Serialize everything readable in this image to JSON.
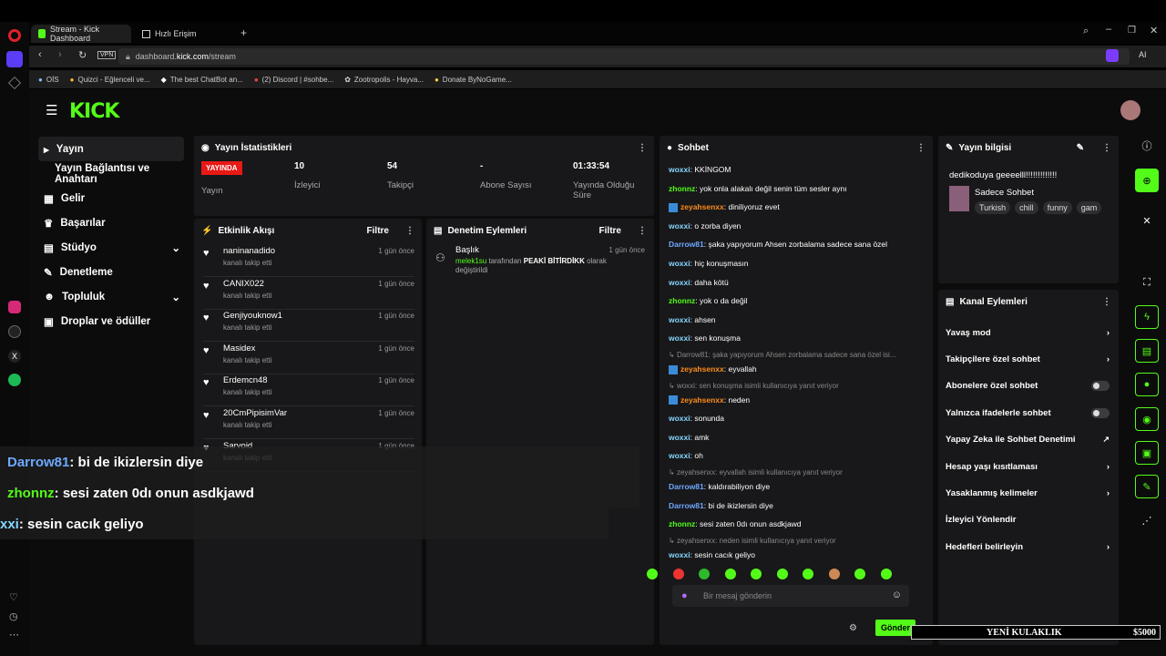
{
  "browser": {
    "tabs": [
      {
        "label": "Stream - Kick Dashboard"
      },
      {
        "label": "Hızlı Erişim"
      }
    ],
    "url_prefix": "dashboard.",
    "url_host": "kick.com",
    "url_path": "/stream",
    "vpn": "VPN",
    "ai": "AI",
    "bookmarks": [
      "OİS",
      "Quizci - Eğlenceli ve...",
      "The best ChatBot an...",
      "(2) Discord | #sohbe...",
      "Zootropolis - Hayva...",
      "Donate ByNoGame..."
    ]
  },
  "nav": {
    "items": [
      {
        "label": "Yayın",
        "icon": "broadcast-icon"
      },
      {
        "label": "Yayın Bağlantısı ve Anahtarı",
        "icon": ""
      },
      {
        "label": "Gelir",
        "icon": "chart-icon"
      },
      {
        "label": "Başarılar",
        "icon": "trophy-icon"
      },
      {
        "label": "Stüdyo",
        "icon": "studio-icon"
      },
      {
        "label": "Denetleme",
        "icon": "wrench-icon"
      },
      {
        "label": "Topluluk",
        "icon": "community-icon"
      },
      {
        "label": "Droplar ve ödüller",
        "icon": "gift-icon"
      }
    ]
  },
  "stats": {
    "title": "Yayın İstatistikleri",
    "live": "YAYINDA",
    "items": [
      {
        "value": "",
        "label": "Yayın"
      },
      {
        "value": "10",
        "label": "İzleyici"
      },
      {
        "value": "54",
        "label": "Takipçi"
      },
      {
        "value": "-",
        "label": "Abone Sayısı"
      },
      {
        "value": "01:33:54",
        "label": "Yayında Olduğu Süre"
      }
    ]
  },
  "activity": {
    "title": "Etkinlik Akışı",
    "filter": "Filtre",
    "items": [
      {
        "name": "naninanadido",
        "sub": "kanalı takip etti",
        "time": "1 gün önce"
      },
      {
        "name": "CANIX022",
        "sub": "kanalı takip etti",
        "time": "1 gün önce"
      },
      {
        "name": "Genjiyouknow1",
        "sub": "kanalı takip etti",
        "time": "1 gün önce"
      },
      {
        "name": "Masidex",
        "sub": "kanalı takip etti",
        "time": "1 gün önce"
      },
      {
        "name": "Erdemcn48",
        "sub": "kanalı takip etti",
        "time": "1 gün önce"
      },
      {
        "name": "20CmPipisimVar",
        "sub": "kanalı takip etti",
        "time": "1 gün önce"
      },
      {
        "name": "Sarvoid",
        "sub": "kanalı takip etti",
        "time": "1 gün önce"
      }
    ]
  },
  "moderation": {
    "title": "Denetim Eylemleri",
    "filter": "Filtre",
    "item_title": "Başlık",
    "item_user": "melek1su",
    "item_mid": " tarafından ",
    "item_value": "PEAKİ BİTİRDİKK",
    "item_end": " olarak değiştirildi",
    "time": "1 gün önce"
  },
  "chat": {
    "title": "Sohbet",
    "placeholder": "Bir mesaj gönderin",
    "send": "Gönder",
    "lines": [
      {
        "user": "woxxi",
        "text": "KKİNGOM",
        "color": "#84d6ff"
      },
      {
        "user": "zhonnz",
        "text": "yok onla alakalı değil senin tüm sesler aynı",
        "color": "#53fc18"
      },
      {
        "user": "zeyahsenxx",
        "text": "diniliyoruz evet",
        "color": "#ff8c1a"
      },
      {
        "user": "woxxi",
        "text": "o zorba diyen",
        "color": "#84d6ff"
      },
      {
        "user": "Darrow81",
        "text": "şaka yapıyorum Ahsen zorbalama sadece sana özel",
        "color": "#6ea8ff"
      },
      {
        "user": "woxxi",
        "text": "hiç konuşmasın",
        "color": "#84d6ff"
      },
      {
        "user": "woxxi",
        "text": "daha kötü",
        "color": "#84d6ff"
      },
      {
        "user": "zhonnz",
        "text": "yok o da değil",
        "color": "#53fc18"
      },
      {
        "user": "woxxi",
        "text": "ahsen",
        "color": "#84d6ff"
      },
      {
        "user": "woxxi",
        "text": "sen konuşma",
        "color": "#84d6ff"
      },
      {
        "reply": "Darrow81: şaka yapıyorum Ahsen zorbalama sadece sana özel isi..."
      },
      {
        "user": "zeyahsenxx",
        "text": "eyvallah",
        "color": "#ff8c1a"
      },
      {
        "reply": "woxxi: sen konuşma isimli kullanıcıya yanıt veriyor"
      },
      {
        "user": "zeyahsenxx",
        "text": "neden",
        "color": "#ff8c1a"
      },
      {
        "user": "woxxi",
        "text": "sonunda",
        "color": "#84d6ff"
      },
      {
        "user": "woxxi",
        "text": "amk",
        "color": "#84d6ff"
      },
      {
        "user": "woxxi",
        "text": "oh",
        "color": "#84d6ff"
      },
      {
        "reply": "zeyahsenxx: eyvallah isimli kullanıcıya yanıt veriyor"
      },
      {
        "user": "Darrow81",
        "text": "kaldırabiliyon diye",
        "color": "#6ea8ff"
      },
      {
        "user": "Darrow81",
        "text": "bi de ikizlersin diye",
        "color": "#6ea8ff"
      },
      {
        "user": "zhonnz",
        "text": "sesi zaten 0dı onun asdkjawd",
        "color": "#53fc18"
      },
      {
        "reply": "zeyahsenxx: neden isimli kullanıcıya yanıt veriyor"
      },
      {
        "user": "woxxi",
        "text": "sesin cacık geliyo",
        "color": "#84d6ff"
      }
    ]
  },
  "info": {
    "title": "Yayın bilgisi",
    "stream_title": "dedikoduya geeeelll!!!!!!!!!!!!!",
    "category": "Sadece Sohbet",
    "tags": [
      "Turkish",
      "chill",
      "funny",
      "gam"
    ]
  },
  "channel": {
    "title": "Kanal Eylemleri",
    "rows": [
      {
        "label": "Yavaş mod",
        "kind": "arrow"
      },
      {
        "label": "Takipçilere özel sohbet",
        "kind": "arrow"
      },
      {
        "label": "Abonelere özel sohbet",
        "kind": "toggle"
      },
      {
        "label": "Yalnızca ifadelerle sohbet",
        "kind": "toggle"
      },
      {
        "label": "Yapay Zeka ile Sohbet Denetimi",
        "kind": "ext"
      },
      {
        "label": "Hesap yaşı kısıtlaması",
        "kind": "arrow"
      },
      {
        "label": "Yasaklanmış kelimeler",
        "kind": "arrow"
      },
      {
        "label": "İzleyici Yönlendir",
        "kind": "none"
      },
      {
        "label": "Hedefleri belirleyin",
        "kind": "arrow"
      }
    ]
  },
  "overlay": [
    {
      "user": "Darrow81",
      "text": " : bi de ikizlersin diye",
      "color": "#6ea8ff"
    },
    {
      "user": "zhonnz",
      "text": " : sesi zaten 0dı onun asdkjawd",
      "color": "#53fc18"
    },
    {
      "user": "xxi",
      "text": " : sesin cacık geliyo",
      "color": "#84d6ff"
    }
  ],
  "ticker": {
    "label": "YENİ KULAKLIK",
    "amount": "$5000"
  }
}
